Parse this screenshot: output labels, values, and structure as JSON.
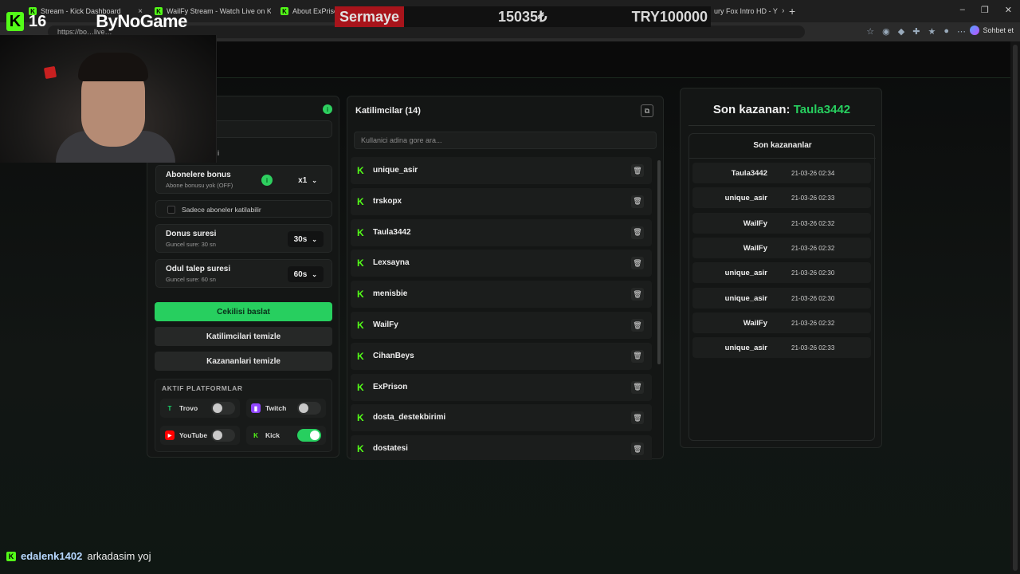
{
  "tabs": [
    {
      "label": "Stream - Kick Dashboard",
      "x": "×"
    },
    {
      "label": "WailFy Stream - Watch Live on Kick",
      "x": "×"
    },
    {
      "label": "About ExPrison",
      "x": ""
    },
    {
      "label": "ury Fox Intro HD - Y",
      "x": "×"
    }
  ],
  "browser": {
    "url": "https://bo…live…",
    "chat_label": "Sohbet et",
    "new_tab": "+"
  },
  "overlay": {
    "brand_num": "16",
    "brand_name": "ByNoGame",
    "ticker_label": "Sermaye",
    "ticker_value1": "15035₺",
    "ticker_value2": "TRY100000"
  },
  "settings": {
    "partial_label": "i",
    "sub_bonus_title": "Abonelere bonus",
    "sub_bonus_sub": "Abone bonusu yok (OFF)",
    "sub_bonus_value": "x1",
    "subs_only_label": "Sadece aboneler katilabilir",
    "round_title": "Donus suresi",
    "round_sub": "Guncel sure: 30 sn",
    "round_value": "30s",
    "claim_title": "Odul talep suresi",
    "claim_sub": "Guncel sure: 60 sn",
    "claim_value": "60s",
    "start_btn": "Cekilisi baslat",
    "clear_participants_btn": "Katilimcilari temizle",
    "clear_winners_btn": "Kazananlari temizle",
    "platforms_title": "AKTIF PLATFORMLAR",
    "platforms": [
      {
        "name": "Trovo",
        "on": false,
        "color": "#19d66b",
        "glyph": "T"
      },
      {
        "name": "Twitch",
        "on": false,
        "color": "#9146ff",
        "glyph": "▮"
      },
      {
        "name": "YouTube",
        "on": false,
        "color": "#ff0000",
        "glyph": "▶"
      },
      {
        "name": "Kick",
        "on": true,
        "color": "#53fc18",
        "glyph": "K"
      }
    ]
  },
  "participants": {
    "header": "Katilimcilar (14)",
    "search_placeholder": "Kullanici adina gore ara...",
    "items": [
      "unique_asir",
      "trskopx",
      "Taula3442",
      "Lexsayna",
      "menisbie",
      "WailFy",
      "CihanBeys",
      "ExPrison",
      "dosta_destekbirimi",
      "dostatesi"
    ]
  },
  "winners": {
    "last_winner_label": "Son kazanan:",
    "last_winner_name": "Taula3442",
    "list_title": "Son kazananlar",
    "items": [
      {
        "name": "Taula3442",
        "date": "21-03-26 02:34"
      },
      {
        "name": "unique_asir",
        "date": "21-03-26 02:33"
      },
      {
        "name": "WailFy",
        "date": "21-03-26 02:32"
      },
      {
        "name": "WailFy",
        "date": "21-03-26 02:32"
      },
      {
        "name": "unique_asir",
        "date": "21-03-26 02:30"
      },
      {
        "name": "unique_asir",
        "date": "21-03-26 02:30"
      },
      {
        "name": "WailFy",
        "date": "21-03-26 02:32"
      },
      {
        "name": "unique_asir",
        "date": "21-03-26 02:33"
      }
    ]
  },
  "chat": {
    "user": "edalenk1402",
    "message": "arkadasim yoj"
  },
  "colors": {
    "accent": "#27cf5f",
    "kick": "#53fc18"
  }
}
